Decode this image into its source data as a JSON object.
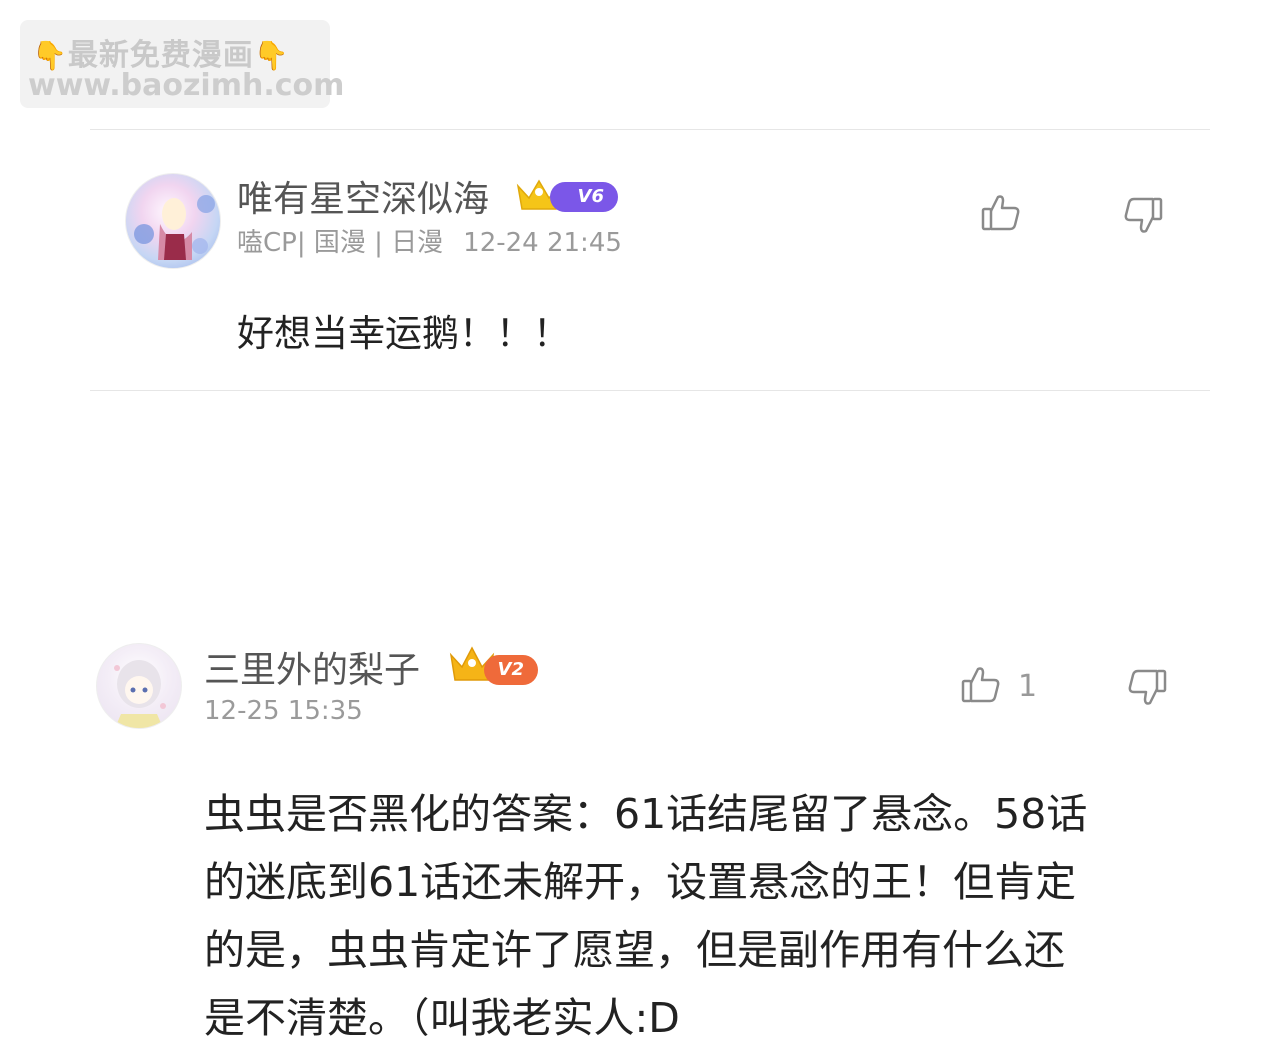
{
  "watermark": {
    "line1": "最新免费漫画",
    "line2": "www.baozimh.com",
    "hand_icon": "pointing-down-hand-emoji"
  },
  "comments": [
    {
      "username": "唯有星空深似海",
      "level": "V6",
      "badge_color": "#7b57e8",
      "crown_color": "#f5c518",
      "tags": "嗑CP| 国漫 | 日漫",
      "time": "12-24 21:45",
      "like_count": "",
      "text": "好想当幸运鹅！！！"
    },
    {
      "username": "三里外的梨子",
      "level": "V2",
      "badge_color": "#ef6a3a",
      "crown_color": "#f5b417",
      "tags": "",
      "time": "12-25 15:35",
      "like_count": "1",
      "text_lines": [
        "虫虫是否黑化的答案：61话结尾留了悬念。58话",
        "的迷底到61话还未解开，设置悬念的王！但肯定",
        "的是，虫虫肯定许了愿望，但是副作用有什么还",
        "是不清楚。（叫我老实人:D"
      ]
    }
  ],
  "icons": {
    "like": "thumbs-up-icon",
    "dislike": "thumbs-down-icon"
  },
  "colors": {
    "icon_gray": "#8a8a8a",
    "divider": "#e6e6e6"
  }
}
